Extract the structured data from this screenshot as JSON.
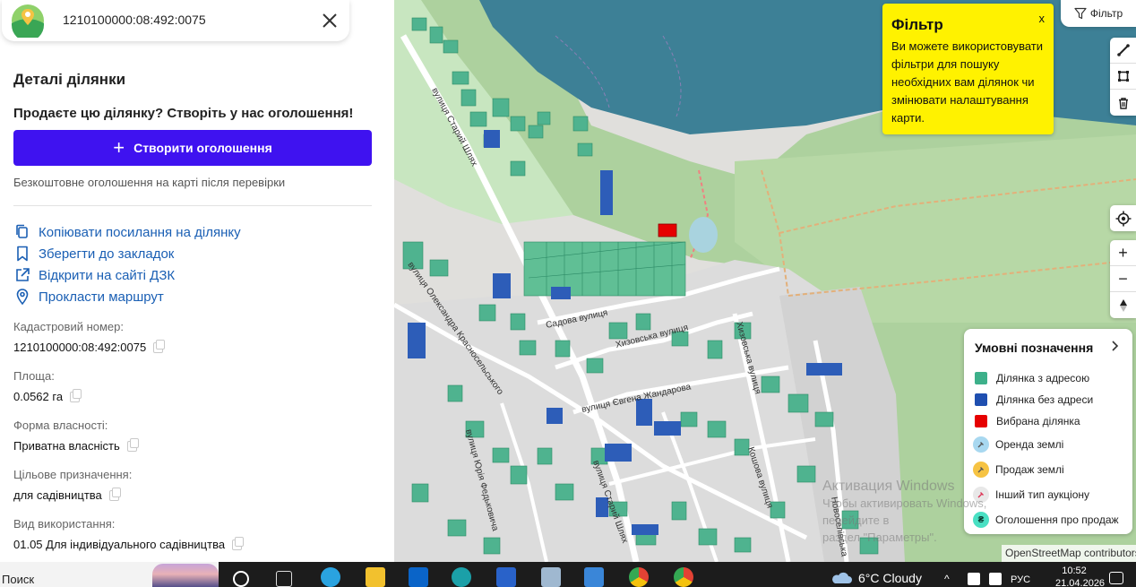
{
  "search": {
    "value": "1210100000:08:492:0075"
  },
  "details": {
    "title": "Деталі ділянки",
    "sell_prompt": "Продаєте цю ділянку? Створіть у нас оголошення!",
    "create_button": "Створити оголошення",
    "free_note": "Безкоштовне оголошення на карті після перевірки"
  },
  "actions": [
    {
      "label": "Копіювати посилання на ділянку",
      "icon": "copy-link-icon"
    },
    {
      "label": "Зберегти до закладок",
      "icon": "bookmark-icon"
    },
    {
      "label": "Відкрити на сайті ДЗК",
      "icon": "external-link-icon"
    },
    {
      "label": "Прокласти маршрут",
      "icon": "map-pin-icon"
    }
  ],
  "fields": [
    {
      "label": "Кадастровий номер:",
      "value": "1210100000:08:492:0075"
    },
    {
      "label": "Площа:",
      "value": "0.0562 га"
    },
    {
      "label": "Форма власності:",
      "value": "Приватна власність"
    },
    {
      "label": "Цільове призначення:",
      "value": "для садівництва"
    },
    {
      "label": "Вид використання:",
      "value": "01.05 Для індивідуального садівництва"
    }
  ],
  "filter": {
    "button_label": "Фільтр",
    "popup_title": "Фільтр",
    "popup_text": "Ви можете використовувати фільтри для пошуку необхідних вам ділянок чи змінювати налаштування карти.",
    "popup_close": "x"
  },
  "legend": {
    "title": "Умовні позначення",
    "items": [
      {
        "label": "Ділянка з адресою",
        "color": "#3db08a"
      },
      {
        "label": "Ділянка без адреси",
        "color": "#1f4fb0"
      },
      {
        "label": "Вибрана ділянка",
        "color": "#e60000"
      },
      {
        "label": "Оренда землі",
        "color": "#a8d8f0"
      },
      {
        "label": "Продаж землі",
        "color": "#f6c343"
      },
      {
        "label": "Інший тип аукціону",
        "color": "#e8e8e8"
      },
      {
        "label": "Оголошення про продаж",
        "color": "#49e0c3",
        "glyph": "₴"
      }
    ]
  },
  "streets": [
    "вулиця Старий Шлях",
    "вулиця Олександра Красносельського",
    "Садова вулиця",
    "Хизовська вулиця",
    "вулиця Євгена Жандарова",
    "Хизовська вулиця",
    "вулиця Юрія Федьковича",
    "вулиця Старий Шлях",
    "Кошова вулиця",
    "Новоселівська"
  ],
  "watermark": {
    "line1": "Активация Windows",
    "line2": "Чтобы активировать Windows, перейдите в",
    "line3": "раздел \"Параметры\"."
  },
  "attribution": "OpenStreetMap contributors",
  "taskbar": {
    "search": "Поиск",
    "weather": "6°C  Cloudy",
    "lang": "РУС",
    "time": "10:52",
    "date": "21.04.2026"
  }
}
